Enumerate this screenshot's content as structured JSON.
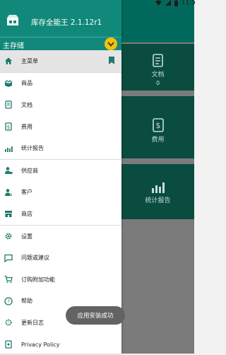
{
  "status_bar": {
    "time": "11:5"
  },
  "drawer": {
    "app_title": "库存全能王 2.1.12r1",
    "database": {
      "label": "主存储"
    },
    "menu": [
      {
        "label": "主菜单",
        "icon": "home-icon"
      },
      {
        "label": "商品",
        "icon": "box-open-icon"
      },
      {
        "label": "文档",
        "icon": "document-icon"
      },
      {
        "label": "费用",
        "icon": "receipt-dollar-icon"
      },
      {
        "label": "统计报告",
        "icon": "bar-chart-icon"
      },
      {
        "label": "供应商",
        "icon": "supplier-icon"
      },
      {
        "label": "客户",
        "icon": "customer-icon"
      },
      {
        "label": "商店",
        "icon": "store-icon"
      },
      {
        "label": "设置",
        "icon": "gear-icon"
      },
      {
        "label": "问题或建议",
        "icon": "message-icon"
      },
      {
        "label": "订购附加功能",
        "icon": "cart-icon"
      },
      {
        "label": "帮助",
        "icon": "help-icon"
      },
      {
        "label": "更新日志",
        "icon": "changelog-icon"
      },
      {
        "label": "Privacy Policy",
        "icon": "privacy-icon"
      }
    ]
  },
  "background_tiles": [
    {
      "label": "文档",
      "count": "0",
      "icon": "document-icon"
    },
    {
      "label": "费用",
      "icon": "receipt-dollar-icon"
    },
    {
      "label": "统计报告",
      "icon": "bar-chart-icon"
    }
  ],
  "toast": {
    "message": "应用安装成功"
  },
  "colors": {
    "header": "#11897a",
    "accent": "#f4c20d",
    "icon": "#1f7a6c",
    "tile": "#0a4c40",
    "scrim": "#7b7b7b"
  }
}
